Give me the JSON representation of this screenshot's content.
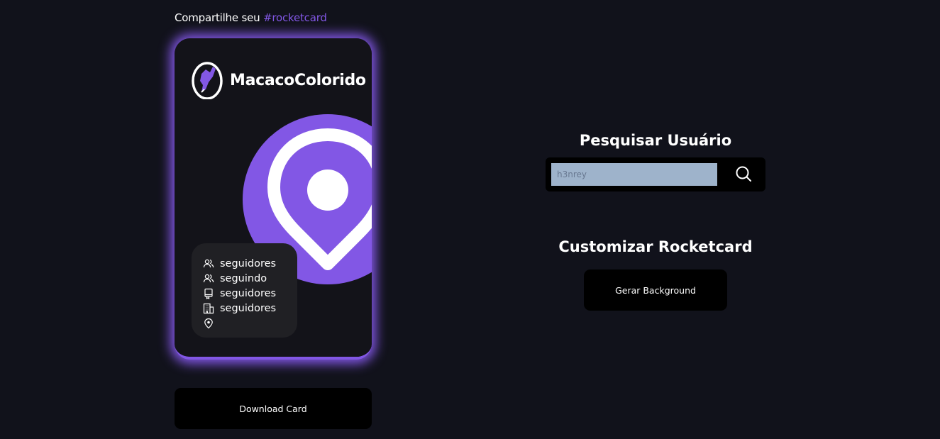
{
  "share": {
    "prefix": "Compartilhe seu ",
    "hashtag": "#rocketcard"
  },
  "card": {
    "username": "MacacoColorido",
    "stats": [
      {
        "icon": "users-icon",
        "label": "seguidores"
      },
      {
        "icon": "users-icon",
        "label": "seguindo"
      },
      {
        "icon": "book-icon",
        "label": "seguidores"
      },
      {
        "icon": "building-icon",
        "label": "seguidores"
      },
      {
        "icon": "map-pin-icon",
        "label": ""
      }
    ],
    "accent": "#8257e5"
  },
  "download": {
    "label": "Download Card"
  },
  "search": {
    "title": "Pesquisar Usuário",
    "placeholder": "h3nrey",
    "value": ""
  },
  "customize": {
    "title": "Customizar Rocketcard",
    "button_label": "Gerar Background"
  },
  "colors": {
    "background": "#11121b",
    "accent": "#8257e5",
    "panel": "#202024",
    "input": "#9eb3cb"
  }
}
